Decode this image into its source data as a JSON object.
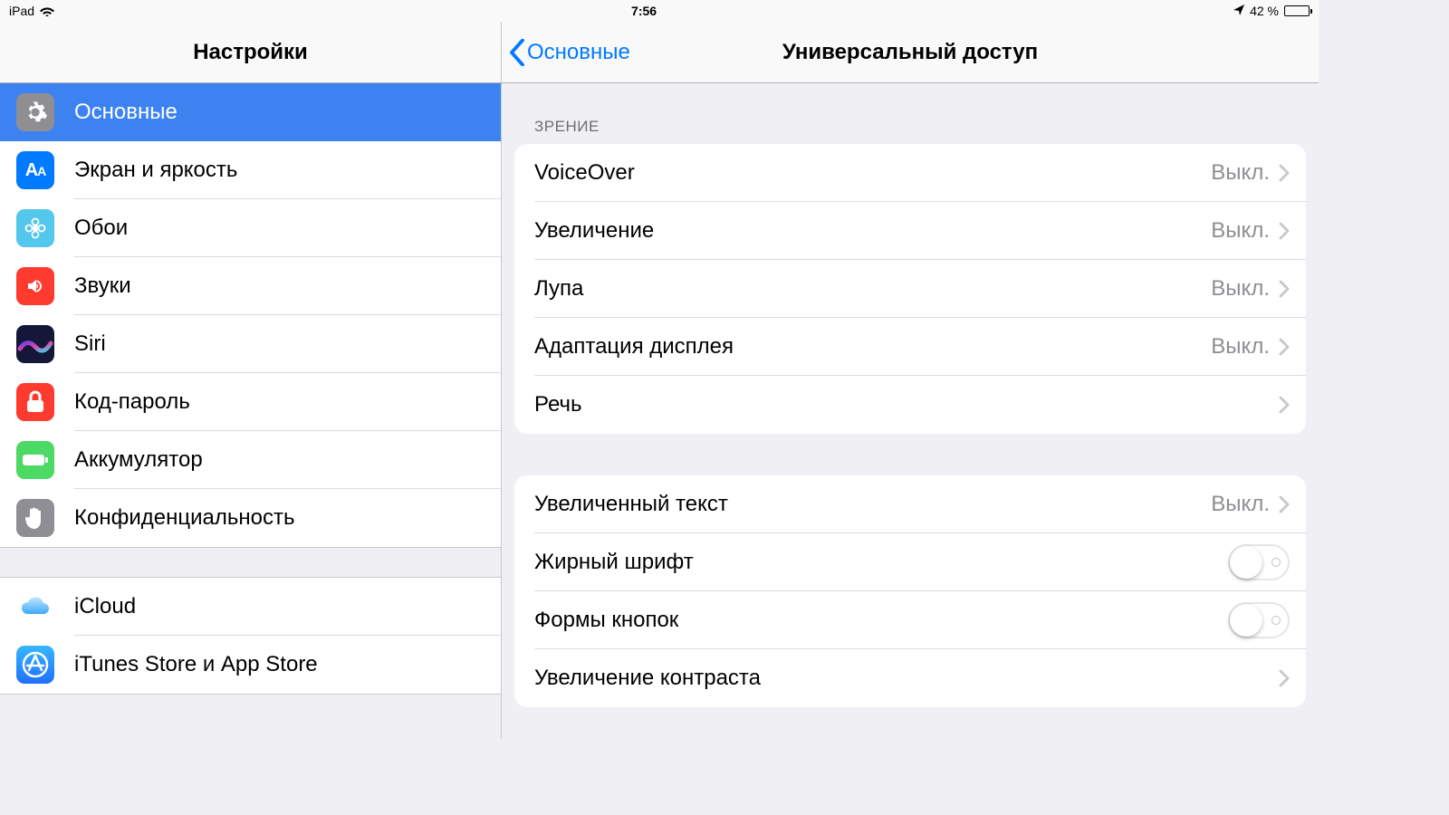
{
  "status": {
    "device": "iPad",
    "time": "7:56",
    "battery_text": "42 %",
    "battery_level": 42
  },
  "sidebar": {
    "title": "Настройки",
    "groups": [
      {
        "items": [
          {
            "key": "general",
            "label": "Основные",
            "icon": "gear",
            "bg": "#8e8e93",
            "selected": true
          },
          {
            "key": "display",
            "label": "Экран и яркость",
            "icon": "aa",
            "bg": "#007aff",
            "selected": false
          },
          {
            "key": "wallpaper",
            "label": "Обои",
            "icon": "flower",
            "bg": "#54c7ec",
            "selected": false
          },
          {
            "key": "sounds",
            "label": "Звуки",
            "icon": "speaker",
            "bg": "#ff3b30",
            "selected": false
          },
          {
            "key": "siri",
            "label": "Siri",
            "icon": "siri",
            "bg": "#1b1f3b",
            "selected": false
          },
          {
            "key": "passcode",
            "label": "Код-пароль",
            "icon": "lock",
            "bg": "#ff3b30",
            "selected": false
          },
          {
            "key": "battery",
            "label": "Аккумулятор",
            "icon": "battery",
            "bg": "#4cd964",
            "selected": false
          },
          {
            "key": "privacy",
            "label": "Конфиденциальность",
            "icon": "hand",
            "bg": "#8e8e93",
            "selected": false
          }
        ]
      },
      {
        "items": [
          {
            "key": "icloud",
            "label": "iCloud",
            "icon": "cloud",
            "bg": "#ffffff",
            "selected": false
          },
          {
            "key": "appstore",
            "label": "iTunes Store и App Store",
            "icon": "appstore",
            "bg": "#1e90ff",
            "selected": false
          }
        ]
      }
    ]
  },
  "detail": {
    "back_label": "Основные",
    "title": "Универсальный доступ",
    "value_off": "Выкл.",
    "sections": [
      {
        "header": "ЗРЕНИЕ",
        "rows": [
          {
            "label": "VoiceOver",
            "type": "disclosure",
            "value": "Выкл."
          },
          {
            "label": "Увеличение",
            "type": "disclosure",
            "value": "Выкл."
          },
          {
            "label": "Лупа",
            "type": "disclosure",
            "value": "Выкл."
          },
          {
            "label": "Адаптация дисплея",
            "type": "disclosure",
            "value": "Выкл."
          },
          {
            "label": "Речь",
            "type": "disclosure",
            "value": ""
          }
        ]
      },
      {
        "header": "",
        "rows": [
          {
            "label": "Увеличенный текст",
            "type": "disclosure",
            "value": "Выкл."
          },
          {
            "label": "Жирный шрифт",
            "type": "toggle",
            "on": false
          },
          {
            "label": "Формы кнопок",
            "type": "toggle",
            "on": false
          },
          {
            "label": "Увеличение контраста",
            "type": "disclosure",
            "value": ""
          }
        ]
      }
    ]
  },
  "colors": {
    "tint": "#007aff"
  }
}
